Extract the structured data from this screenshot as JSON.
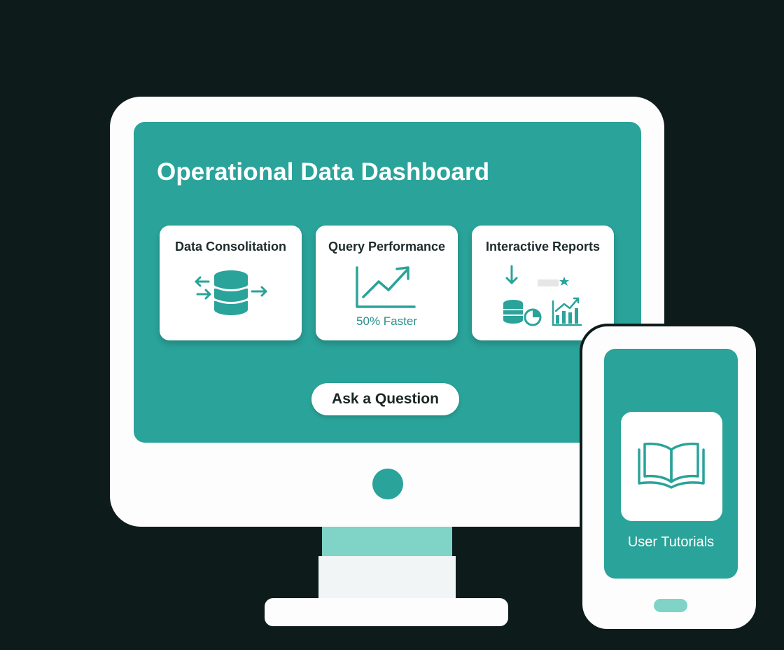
{
  "dashboard": {
    "title": "Operational Data Dashboard"
  },
  "cards": [
    {
      "title": "Data Consolitation",
      "icon": "database-arrows-icon"
    },
    {
      "title": "Query Performance",
      "icon": "line-chart-up-icon",
      "stat": "50% Faster"
    },
    {
      "title": "Interactive Reports",
      "icon": "reports-icon"
    }
  ],
  "ask_button": {
    "label": "Ask a Question"
  },
  "phone": {
    "tile_icon": "open-book-icon",
    "tile_label": "User Tutorials"
  },
  "colors": {
    "background": "#0d1b1b",
    "screen_teal": "#2aa39a",
    "accent_mint": "#7fd3c7",
    "white": "#ffffff",
    "text_dark": "#1e2b2b"
  }
}
